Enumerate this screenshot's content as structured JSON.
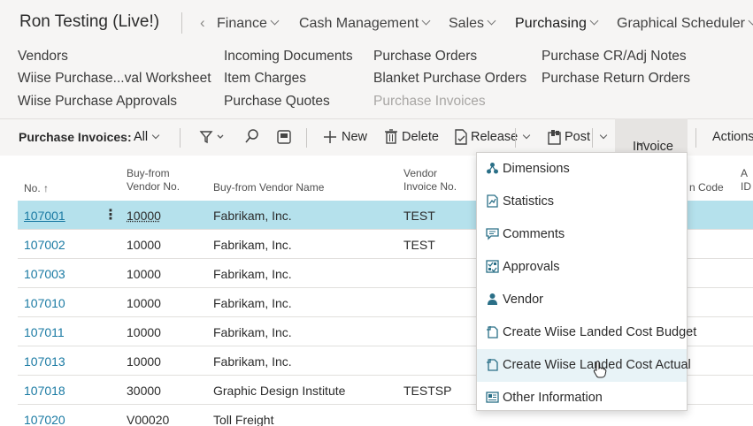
{
  "company": "Ron Testing (Live!)",
  "nav": [
    {
      "label": "Finance"
    },
    {
      "label": "Cash Management"
    },
    {
      "label": "Sales"
    },
    {
      "label": "Purchasing"
    },
    {
      "label": "Graphical Scheduler"
    }
  ],
  "links": [
    {
      "label": "Vendors"
    },
    {
      "label": "Wiise Purchase...val Worksheet"
    },
    {
      "label": "Wiise Purchase Approvals"
    },
    {
      "label": "Incoming Documents"
    },
    {
      "label": "Item Charges"
    },
    {
      "label": "Purchase Quotes"
    },
    {
      "label": "Purchase Orders"
    },
    {
      "label": "Blanket Purchase Orders"
    },
    {
      "label": "Purchase Invoices"
    },
    {
      "label": "Purchase CR/Adj Notes"
    },
    {
      "label": "Purchase Return Orders"
    }
  ],
  "actionbar": {
    "title": "Purchase Invoices:",
    "filter": "All",
    "new": "New",
    "delete": "Delete",
    "release": "Release",
    "post": "Post",
    "invoice": "Invoice",
    "actions": "Actions"
  },
  "columns": {
    "no": "No.",
    "vendor_no_1": "Buy-from",
    "vendor_no_2": "Vendor No.",
    "vendor_name": "Buy-from Vendor Name",
    "vendor_inv_1": "Vendor",
    "vendor_inv_2": "Invoice No.",
    "location": "n Code",
    "extra_1": "A",
    "extra_2": "ID"
  },
  "rows": [
    {
      "no": "107001",
      "vendor": "10000",
      "name": "Fabrikam, Inc.",
      "inv": "TEST"
    },
    {
      "no": "107002",
      "vendor": "10000",
      "name": "Fabrikam, Inc.",
      "inv": "TEST"
    },
    {
      "no": "107003",
      "vendor": "10000",
      "name": "Fabrikam, Inc.",
      "inv": ""
    },
    {
      "no": "107010",
      "vendor": "10000",
      "name": "Fabrikam, Inc.",
      "inv": ""
    },
    {
      "no": "107011",
      "vendor": "10000",
      "name": "Fabrikam, Inc.",
      "inv": ""
    },
    {
      "no": "107013",
      "vendor": "10000",
      "name": "Fabrikam, Inc.",
      "inv": ""
    },
    {
      "no": "107018",
      "vendor": "30000",
      "name": "Graphic Design Institute",
      "inv": "TESTSP"
    },
    {
      "no": "107020",
      "vendor": "V00020",
      "name": "Toll Freight",
      "inv": ""
    }
  ],
  "menu": [
    {
      "label": "Dimensions",
      "icon": "dimensions-icon"
    },
    {
      "label": "Statistics",
      "icon": "statistics-icon"
    },
    {
      "label": "Comments",
      "icon": "comments-icon"
    },
    {
      "label": "Approvals",
      "icon": "approvals-icon"
    },
    {
      "label": "Vendor",
      "icon": "vendor-icon"
    },
    {
      "label": "Create Wiise Landed Cost Budget",
      "icon": "landed-cost-icon"
    },
    {
      "label": "Create Wiise Landed Cost Actual",
      "icon": "landed-cost-icon"
    },
    {
      "label": "Other Information",
      "icon": "other-info-icon"
    }
  ],
  "accent_color": "#1a7aa3",
  "selected_row_color": "#b5e1ec"
}
